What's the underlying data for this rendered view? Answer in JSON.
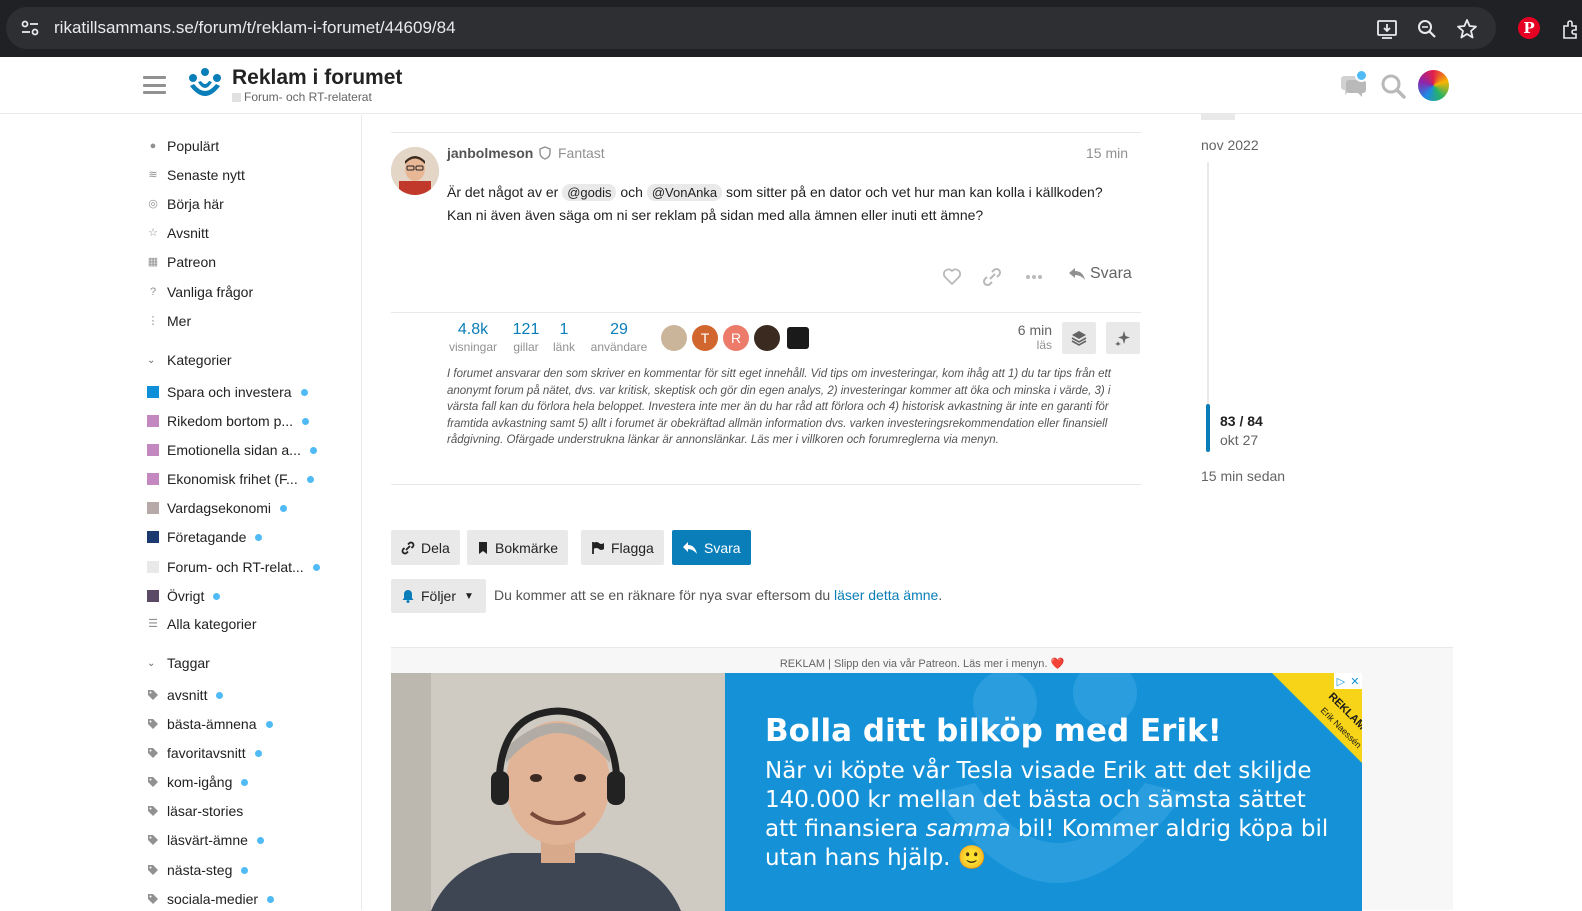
{
  "browser": {
    "url": "rikatillsammans.se/forum/t/reklam-i-forumet/44609/84"
  },
  "header": {
    "topic_title": "Reklam i forumet",
    "category": "Forum- och RT-relaterat"
  },
  "sidebar": {
    "nav": [
      {
        "label": "Populärt",
        "icon": "fire-icon"
      },
      {
        "label": "Senaste nytt",
        "icon": "layers-icon"
      },
      {
        "label": "Börja här",
        "icon": "compass-icon"
      },
      {
        "label": "Avsnitt",
        "icon": "star-icon"
      },
      {
        "label": "Patreon",
        "icon": "gift-icon"
      },
      {
        "label": "Vanliga frågor",
        "icon": "question-icon"
      },
      {
        "label": "Mer",
        "icon": "more-vertical-icon"
      }
    ],
    "categories_header": "Kategorier",
    "categories": [
      {
        "label": "Spara och investera",
        "color": "#0e8fd8"
      },
      {
        "label": "Rikedom bortom p...",
        "color": "#c288bf"
      },
      {
        "label": "Emotionella sidan a...",
        "color": "#c288bf"
      },
      {
        "label": "Ekonomisk frihet (F...",
        "color": "#c288bf"
      },
      {
        "label": "Vardagsekonomi",
        "color": "#b8a9a9"
      },
      {
        "label": "Företagande",
        "color": "#1d3a70"
      },
      {
        "label": "Forum- och RT-relat...",
        "color": "#e9e9e9"
      },
      {
        "label": "Övrigt",
        "color": "#5a4a66"
      }
    ],
    "all_categories": "Alla kategorier",
    "tags_header": "Taggar",
    "tags": [
      {
        "label": "avsnitt",
        "unread": true
      },
      {
        "label": "bästa-ämnena",
        "unread": true
      },
      {
        "label": "favoritavsnitt",
        "unread": true
      },
      {
        "label": "kom-igång",
        "unread": true
      },
      {
        "label": "läsar-stories",
        "unread": false
      },
      {
        "label": "läsvärt-ämne",
        "unread": true
      },
      {
        "label": "nästa-steg",
        "unread": true
      },
      {
        "label": "sociala-medier",
        "unread": true
      }
    ]
  },
  "post": {
    "username": "janbolmeson",
    "user_title": "Fantast",
    "time": "15 min",
    "body_line1_a": "Är det något av er",
    "mention1": "@godis",
    "body_line1_b": "och",
    "mention2": "@VonAnka",
    "body_line1_c": "som sitter på en dator och vet hur man kan kolla i källkoden?",
    "body_line2": "Kan ni även även säga om ni ser reklam på sidan med alla ämnen eller inuti ett ämne?",
    "reply_label": "Svara"
  },
  "topic_map": {
    "stats": [
      {
        "num": "4.8k",
        "label": "visningar"
      },
      {
        "num": "121",
        "label": "gillar"
      },
      {
        "num": "1",
        "label": "länk"
      },
      {
        "num": "29",
        "label": "användare"
      }
    ],
    "participants": [
      {
        "letter": "",
        "color": "#cbb59a"
      },
      {
        "letter": "T",
        "color": "#d1662e"
      },
      {
        "letter": "R",
        "color": "#ec7b6a"
      },
      {
        "letter": "",
        "color": "#3a2a20"
      },
      {
        "letter": "",
        "color": "#1a1a1a"
      }
    ],
    "read_time_num": "6 min",
    "read_time_label": "läs",
    "disclaimer": "I forumet ansvarar den som skriver en kommentar för sitt eget innehåll. Vid tips om investeringar, kom ihåg att 1) du tar tips från ett anonymt forum på nätet, dvs. var kritisk, skeptisk och gör din egen analys, 2) investeringar kommer att öka och minska i värde, 3) i värsta fall kan du förlora hela beloppet. Investera inte mer än du har råd att förlora och 4) historisk avkastning är inte en garanti för framtida avkastning samt 5) allt i forumet är obekräftad allmän information dvs. varken investeringsrekommendation eller finansiell rådgivning. Ofärgade understrukna länkar är annonslänkar. Läs mer i villkoren och forumreglerna via menyn."
  },
  "timeline": {
    "start_date": "nov 2022",
    "position": "83 / 84",
    "position_date": "okt 27",
    "ago": "15 min sedan"
  },
  "footer": {
    "share": "Dela",
    "bookmark": "Bokmärke",
    "flag": "Flagga",
    "reply": "Svara",
    "following": "Följer",
    "notify_text": "Du kommer att se en räknare för nya svar eftersom du ",
    "notify_link": "läser detta ämne",
    "notify_end": "."
  },
  "ad": {
    "label": "REKLAM | Slipp den via vår Patreon. Läs mer i menyn. ❤️",
    "headline": "Bolla ditt bilköp med Erik!",
    "text_a": "När vi köpte vår Tesla visade Erik att det skiljde 140.000 kr mellan det bästa och sämsta sättet att finansiera ",
    "text_em": "samma",
    "text_b": " bil! Kommer aldrig köpa bil utan hans hjälp. 🙂",
    "corner_a": "REKLAM",
    "corner_b": "Erik Naessén",
    "adchoice_a": "▷",
    "adchoice_b": "✕"
  }
}
